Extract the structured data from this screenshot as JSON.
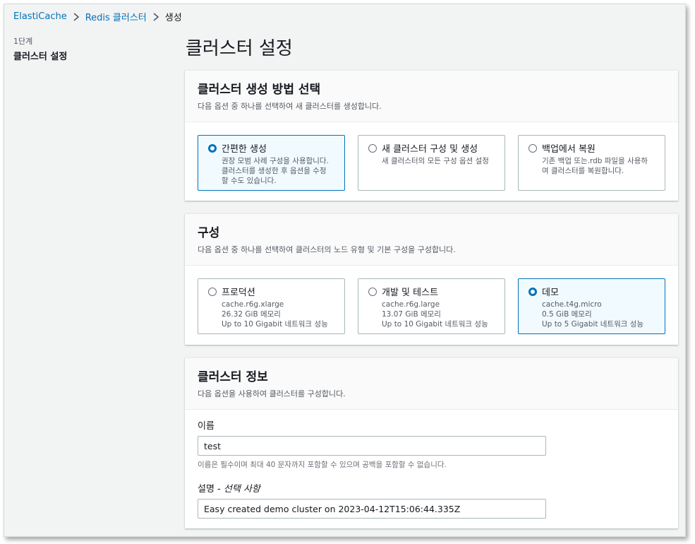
{
  "breadcrumb": {
    "items": [
      "ElastiCache",
      "Redis 클러스터"
    ],
    "current": "생성"
  },
  "sidebar": {
    "step_num": "1단계",
    "step_name": "클러스터 설정"
  },
  "page_title": "클러스터 설정",
  "creation_method": {
    "title": "클러스터 생성 방법 선택",
    "desc": "다음 옵션 중 하나를 선택하여 새 클러스터를 생성합니다.",
    "options": [
      {
        "title": "간편한 생성",
        "lines": [
          "권장 모범 사례 구성을 사용합니다.",
          "클러스터를 생성한 후 옵션을 수정",
          "할 수도 있습니다."
        ],
        "selected": true
      },
      {
        "title": "새 클러스터 구성 및 생성",
        "lines": [
          "새 클러스터의 모든 구성 옵션 설정"
        ],
        "selected": false
      },
      {
        "title": "백업에서 복원",
        "lines": [
          "기존 백업 또는.rdb 파일을 사용하",
          "여 클러스터를 복원합니다."
        ],
        "selected": false
      }
    ]
  },
  "configuration": {
    "title": "구성",
    "desc": "다음 옵션 중 하나를 선택하여 클러스터의 노드 유형 및 기본 구성을 구성합니다.",
    "options": [
      {
        "title": "프로덕션",
        "lines": [
          "cache.r6g.xlarge",
          "26.32 GiB 메모리",
          "Up to 10 Gigabit 네트워크 성능"
        ],
        "selected": false
      },
      {
        "title": "개발 및 테스트",
        "lines": [
          "cache.r6g.large",
          "13.07 GiB 메모리",
          "Up to 10 Gigabit 네트워크 성능"
        ],
        "selected": false
      },
      {
        "title": "데모",
        "lines": [
          "cache.t4g.micro",
          "0.5 GiB 메모리",
          "Up to 5 Gigabit 네트워크 성능"
        ],
        "selected": true
      }
    ]
  },
  "cluster_info": {
    "title": "클러스터 정보",
    "desc": "다음 옵션을 사용하여 클러스터를 구성합니다.",
    "name_label": "이름",
    "name_value": "test",
    "name_hint": "이름은 필수이며 최대 40 문자까지 포함할 수 있으며 공백을 포함할 수 없습니다.",
    "desc_label": "설명",
    "desc_label_optional": "선택 사항",
    "desc_value": "Easy created demo cluster on 2023-04-12T15:06:44.335Z"
  },
  "colors": {
    "link": "#0073bb",
    "selected_border": "#0073bb",
    "selected_bg": "#f1faff",
    "background": "#f2f3f3"
  }
}
